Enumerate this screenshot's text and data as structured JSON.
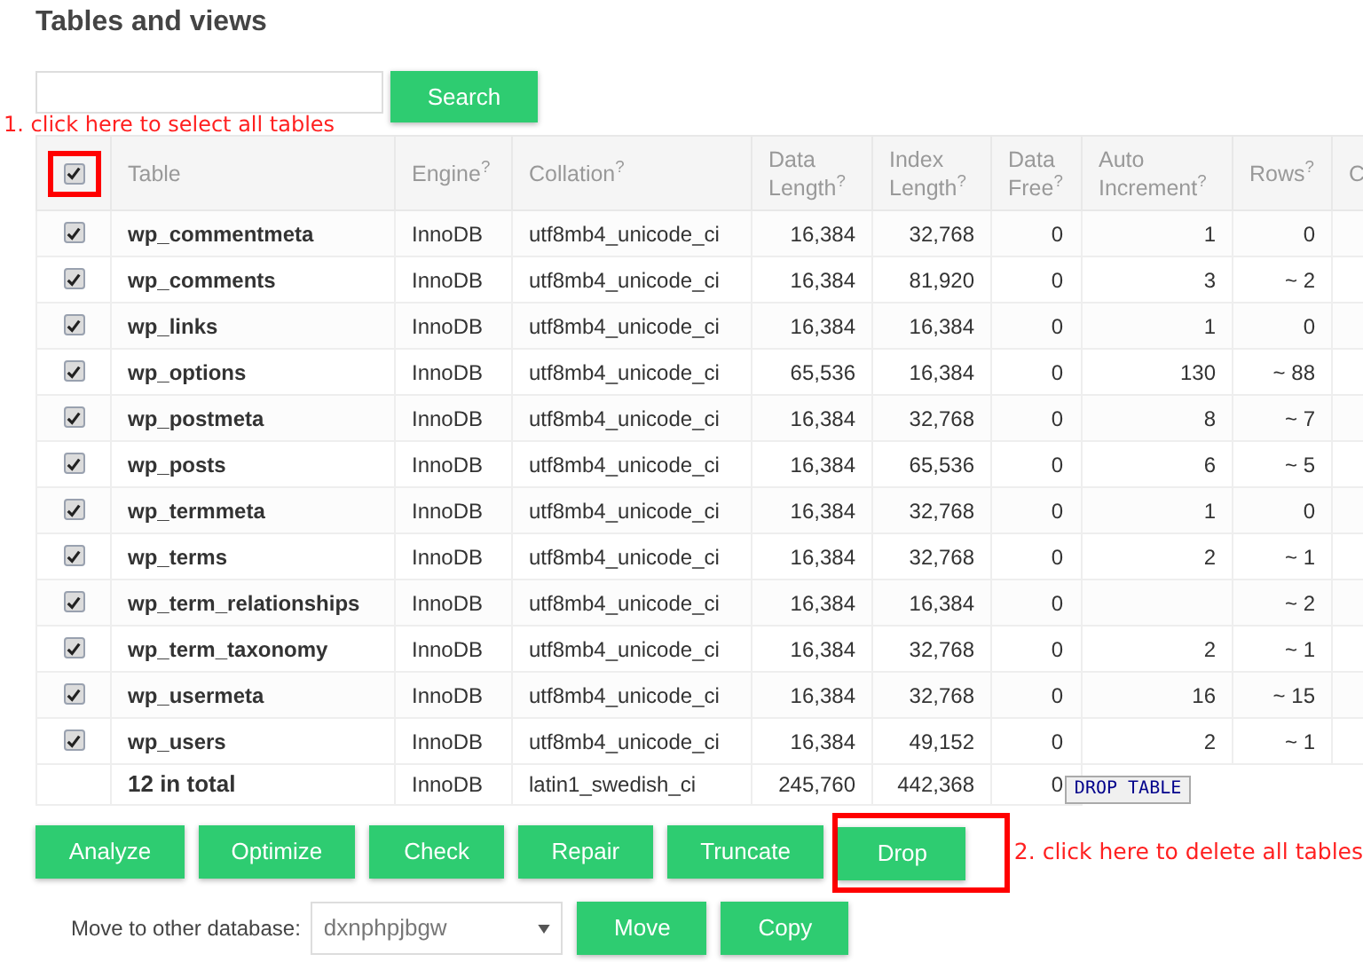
{
  "title": "Tables and views",
  "search": {
    "button": "Search"
  },
  "annotations": [
    "1. click here to select all tables",
    "2. click here to delete all tables"
  ],
  "table": {
    "select_all": {
      "checked": true
    },
    "columns": [
      "Table",
      "Engine$^{?}$",
      "Collation$^{?}$",
      "Data Length$^{?}$",
      "Index Length$^{?}$",
      "Data Free$^{?}$",
      "Auto Increment$^{?}$",
      "Rows$^{?}$",
      "C"
    ],
    "rows": [
      {
        "checked": true,
        "cells": [
          "wp_commentmeta",
          "InnoDB",
          "utf8mb4_unicode_ci",
          "16,384",
          "32,768",
          "0",
          "1",
          "0"
        ]
      },
      {
        "checked": true,
        "cells": [
          "wp_comments",
          "InnoDB",
          "utf8mb4_unicode_ci",
          "16,384",
          "81,920",
          "0",
          "3",
          "~ 2"
        ]
      },
      {
        "checked": true,
        "cells": [
          "wp_links",
          "InnoDB",
          "utf8mb4_unicode_ci",
          "16,384",
          "16,384",
          "0",
          "1",
          "0"
        ]
      },
      {
        "checked": true,
        "cells": [
          "wp_options",
          "InnoDB",
          "utf8mb4_unicode_ci",
          "65,536",
          "16,384",
          "0",
          "130",
          "~ 88"
        ]
      },
      {
        "checked": true,
        "cells": [
          "wp_postmeta",
          "InnoDB",
          "utf8mb4_unicode_ci",
          "16,384",
          "32,768",
          "0",
          "8",
          "~ 7"
        ]
      },
      {
        "checked": true,
        "cells": [
          "wp_posts",
          "InnoDB",
          "utf8mb4_unicode_ci",
          "16,384",
          "65,536",
          "0",
          "6",
          "~ 5"
        ]
      },
      {
        "checked": true,
        "cells": [
          "wp_termmeta",
          "InnoDB",
          "utf8mb4_unicode_ci",
          "16,384",
          "32,768",
          "0",
          "1",
          "0"
        ]
      },
      {
        "checked": true,
        "cells": [
          "wp_terms",
          "InnoDB",
          "utf8mb4_unicode_ci",
          "16,384",
          "32,768",
          "0",
          "2",
          "~ 1"
        ]
      },
      {
        "checked": true,
        "cells": [
          "wp_term_relationships",
          "InnoDB",
          "utf8mb4_unicode_ci",
          "16,384",
          "16,384",
          "0",
          "",
          "~ 2"
        ]
      },
      {
        "checked": true,
        "cells": [
          "wp_term_taxonomy",
          "InnoDB",
          "utf8mb4_unicode_ci",
          "16,384",
          "32,768",
          "0",
          "2",
          "~ 1"
        ]
      },
      {
        "checked": true,
        "cells": [
          "wp_usermeta",
          "InnoDB",
          "utf8mb4_unicode_ci",
          "16,384",
          "32,768",
          "0",
          "16",
          "~ 15"
        ]
      },
      {
        "checked": true,
        "cells": [
          "wp_users",
          "InnoDB",
          "utf8mb4_unicode_ci",
          "16,384",
          "49,152",
          "0",
          "2",
          "~ 1"
        ]
      }
    ],
    "total": [
      "12 in total",
      "InnoDB",
      "latin1_swedish_ci",
      "245,760",
      "442,368",
      "0"
    ]
  },
  "actions": [
    "Analyze",
    "Optimize",
    "Check",
    "Repair",
    "Truncate",
    "Drop"
  ],
  "tooltip": "DROP TABLE",
  "move": {
    "label": "Move to other database:",
    "database": "dxnphpjbgw",
    "buttons": [
      "Move",
      "Copy"
    ]
  }
}
